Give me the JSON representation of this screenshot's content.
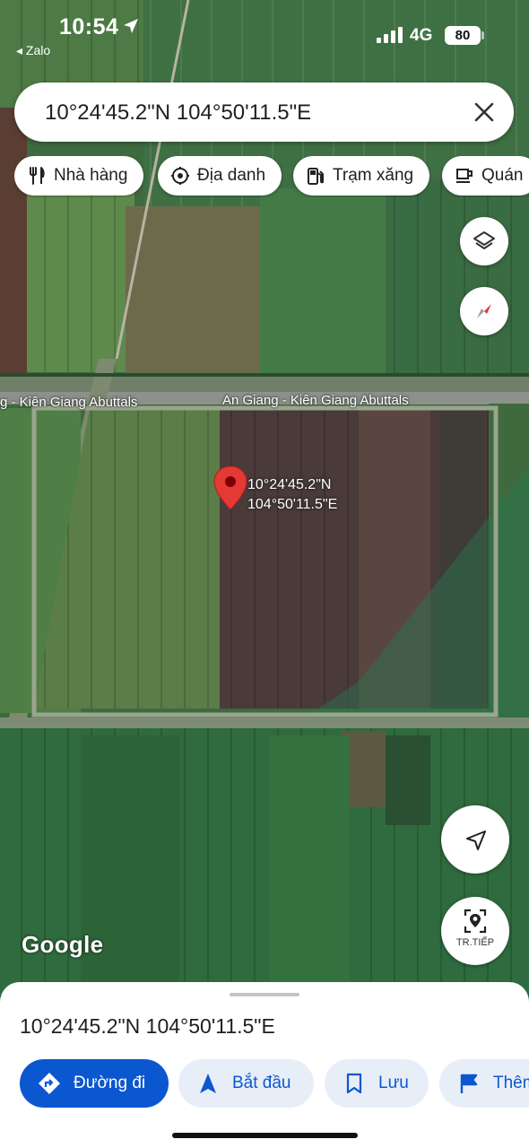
{
  "status_bar": {
    "time": "10:54",
    "back_app": "◂ Zalo",
    "network": "4G",
    "battery": "80"
  },
  "search": {
    "value": "10°24'45.2\"N 104°50'11.5\"E"
  },
  "chips": [
    {
      "label": "Nhà hàng",
      "icon": "fork-knife-icon"
    },
    {
      "label": "Địa danh",
      "icon": "landmark-icon"
    },
    {
      "label": "Trạm xăng",
      "icon": "fuel-pump-icon"
    },
    {
      "label": "Quán",
      "icon": "cafe-cup-icon"
    }
  ],
  "map": {
    "road_label_left": "g - Kiên Giang Abuttals",
    "road_label_right": "An Giang - Kiên Giang Abuttals",
    "pin_lat": "10°24'45.2\"N",
    "pin_lng": "104°50'11.5\"E",
    "pin_color": "#e53935",
    "logo": "Google",
    "next_button_label": "TR.TIẾP"
  },
  "sheet": {
    "title": "10°24'45.2\"N 104°50'11.5\"E",
    "actions": [
      {
        "label": "Đường đi",
        "icon": "directions-icon"
      },
      {
        "label": "Bắt đầu",
        "icon": "navigation-arrow-icon"
      },
      {
        "label": "Lưu",
        "icon": "bookmark-icon"
      },
      {
        "label": "Thêm",
        "icon": "flag-icon"
      }
    ],
    "accent": "#0b57d0"
  }
}
